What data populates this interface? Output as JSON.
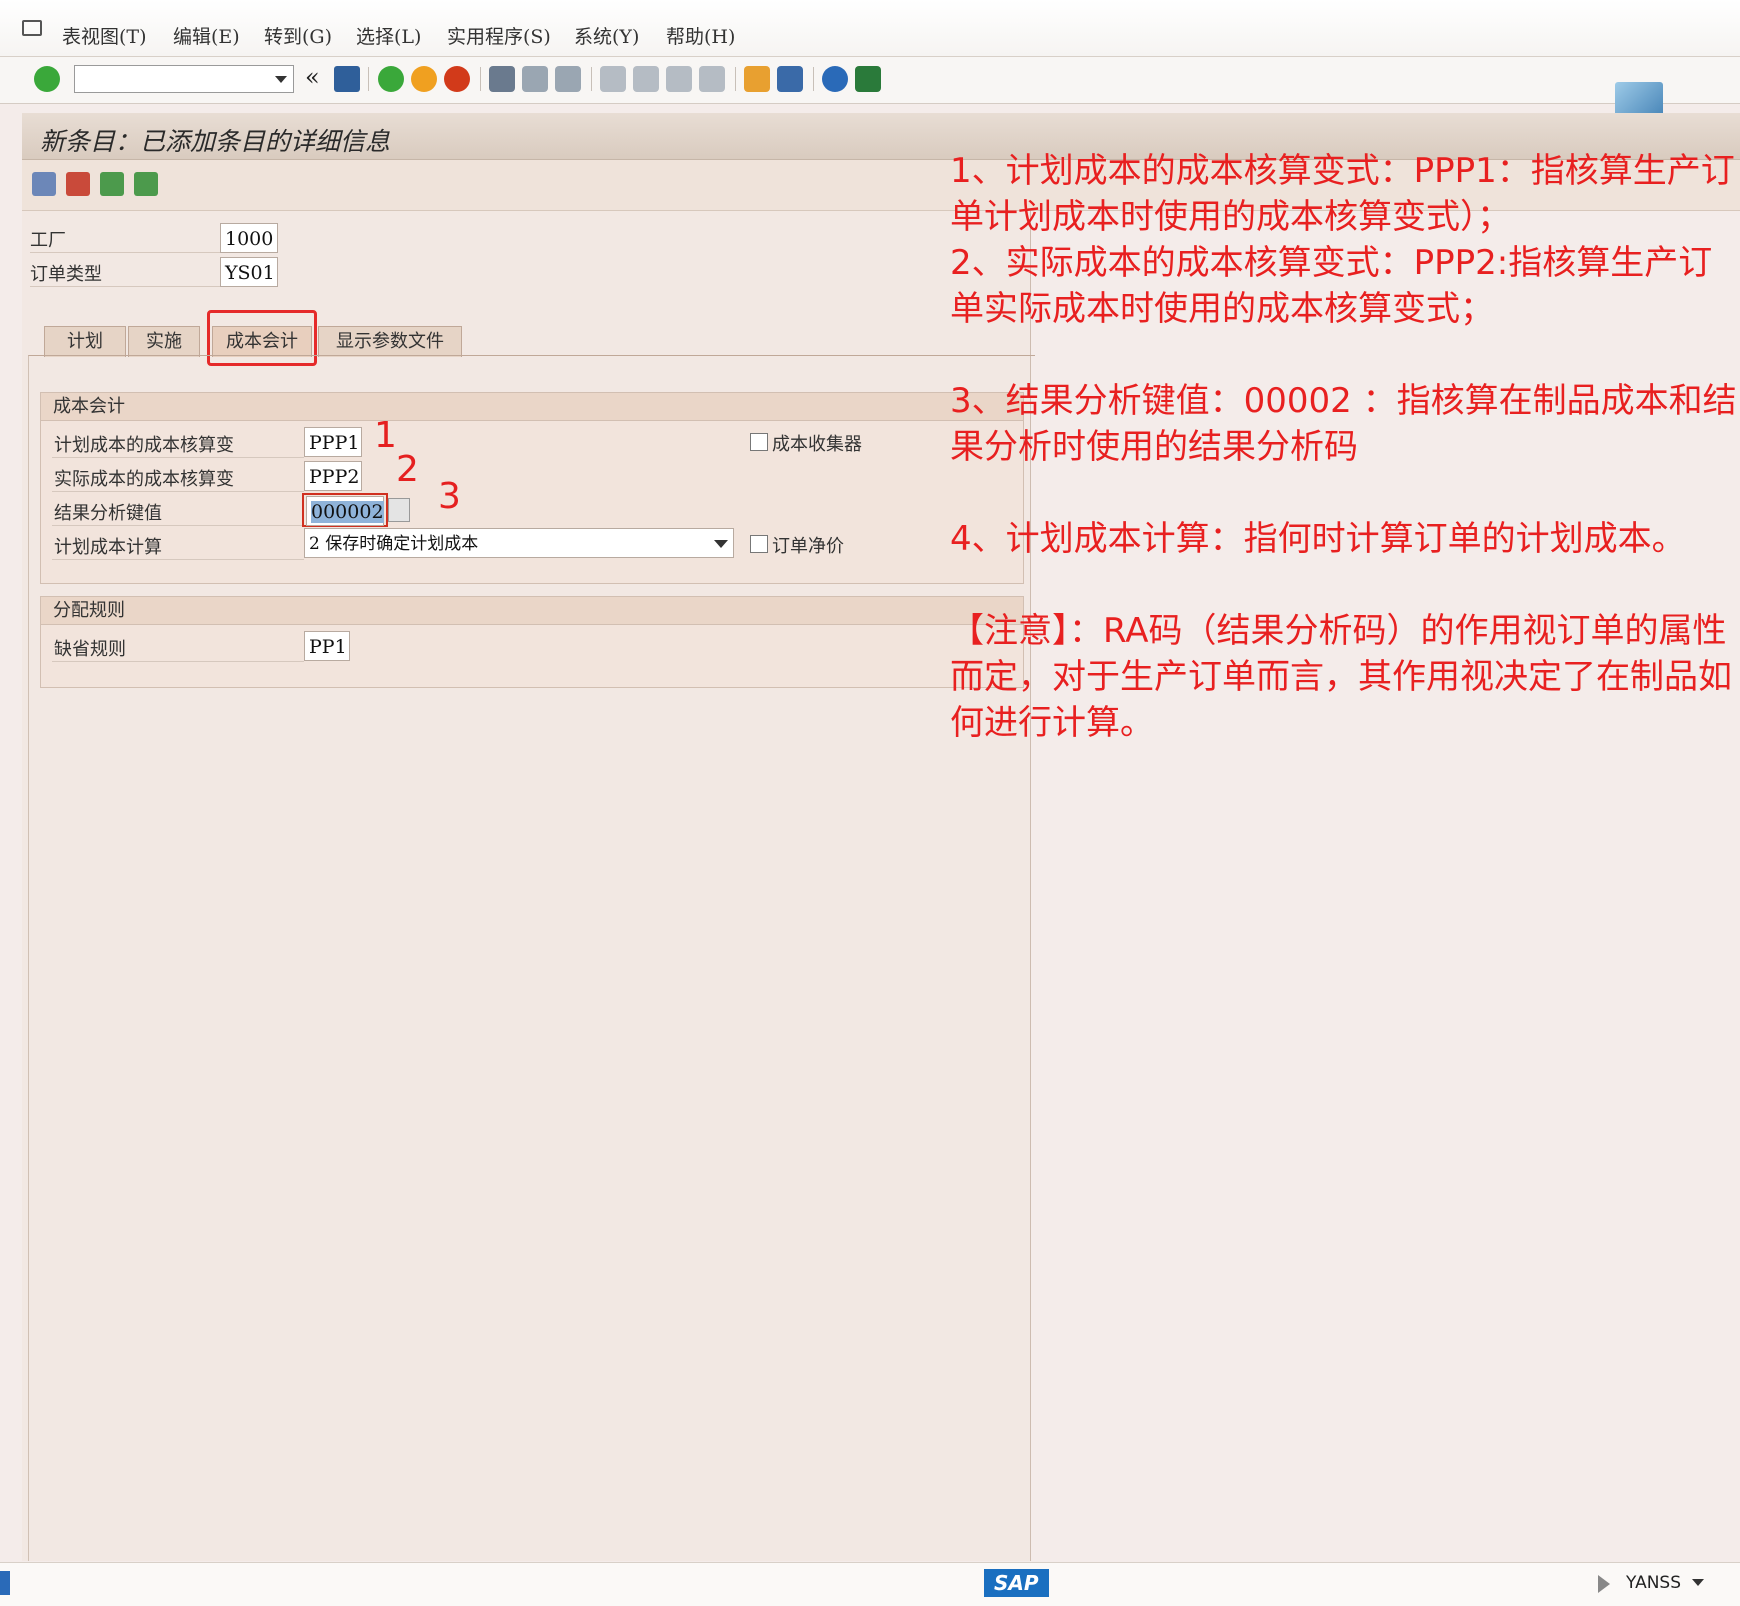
{
  "menu": {
    "items": [
      "表视图(T)",
      "编辑(E)",
      "转到(G)",
      "选择(L)",
      "实用程序(S)",
      "系统(Y)",
      "帮助(H)"
    ]
  },
  "toolbar": {
    "command_value": "",
    "back_glyph": "«",
    "icons": [
      "enter-check-icon",
      "save-icon",
      "back-icon",
      "exit-icon",
      "cancel-icon",
      "print-icon",
      "find-icon",
      "find-next-icon",
      "first-page-icon",
      "prev-page-icon",
      "next-page-icon",
      "last-page-icon",
      "new-session-icon",
      "shortcut-icon",
      "help-icon",
      "customize-layout-icon"
    ]
  },
  "title": "新条目：已添加条目的详细信息",
  "header_fields": {
    "plant_label": "工厂",
    "plant_value": "1000",
    "order_type_label": "订单类型",
    "order_type_value": "YS01"
  },
  "tabs": [
    "计划",
    "实施",
    "成本会计",
    "显示参数文件"
  ],
  "cost_group": {
    "title": "成本会计",
    "planned_variant_label": "计划成本的成本核算变",
    "planned_variant_value": "PPP1",
    "actual_variant_label": "实际成本的成本核算变",
    "actual_variant_value": "PPP2",
    "ra_key_label": "结果分析键值",
    "ra_key_value": "000002",
    "plan_calc_label": "计划成本计算",
    "plan_calc_value": "2 保存时确定计划成本",
    "collector_label": "成本收集器",
    "net_price_label": "订单净价"
  },
  "markers": [
    "1",
    "2",
    "3"
  ],
  "settlement_group": {
    "title": "分配规则",
    "default_rule_label": "缺省规则",
    "default_rule_value": "PP1"
  },
  "annotations": [
    "1、计划成本的成本核算变式：PPP1：指核算生产订单计划成本时使用的成本核算变式）；",
    "2、实际成本的成本核算变式：PPP2:指核算生产订单实际成本时使用的成本核算变式；",
    "3、结果分析键值：00002 ：指核算在制品成本和结果分析时使用的结果分析码",
    "4、计划成本计算：指何时计算订单的计划成本。",
    "【注意】：RA码（结果分析码）的作用视订单的属性而定，对于生产订单而言，其作用视决定了在制品如何进行计算。"
  ],
  "status": {
    "logo": "SAP",
    "user": "YANSS"
  },
  "colors": {
    "annotation_red": "#e82020",
    "highlight_red": "#e52a2a",
    "selected_field": "#8fb3d9"
  }
}
